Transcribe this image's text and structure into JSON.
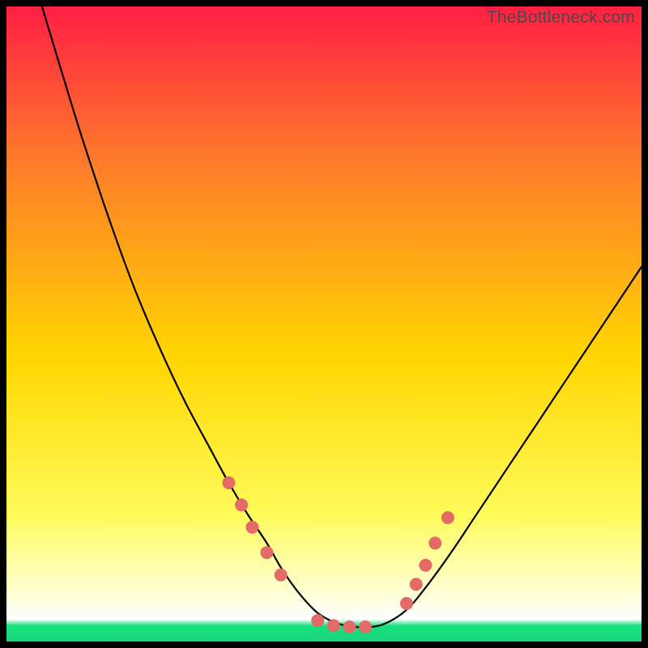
{
  "watermark": "TheBottleneck.com",
  "colors": {
    "grad_top": "#ff1f43",
    "grad_mid1": "#ff7a2c",
    "grad_mid2": "#ffd600",
    "grad_mid3": "#fffb5a",
    "grad_mid4": "#fdffd1",
    "grad_green": "#18e07f",
    "dot": "#e46a67",
    "line": "#000000"
  },
  "chart_data": {
    "type": "line",
    "title": "",
    "xlabel": "",
    "ylabel": "",
    "xlim": [
      0,
      100
    ],
    "ylim": [
      0,
      100
    ],
    "x": [
      5.6,
      8,
      12,
      16,
      20,
      24,
      28,
      32,
      35,
      38,
      41,
      43,
      45,
      47,
      49,
      51,
      53,
      55,
      57.5,
      60,
      63,
      66,
      70,
      74,
      78,
      82,
      86,
      90,
      94,
      98,
      100
    ],
    "y": [
      100,
      92,
      79,
      67,
      56,
      46.5,
      38,
      30.5,
      25,
      20,
      15.5,
      12,
      9,
      6.5,
      4.5,
      3.3,
      2.6,
      2.3,
      2.3,
      3,
      5,
      8.5,
      14,
      20,
      26,
      32,
      38,
      44,
      50,
      56,
      59
    ],
    "dots": [
      {
        "x": 35,
        "y": 25
      },
      {
        "x": 37,
        "y": 21.5
      },
      {
        "x": 38.7,
        "y": 18
      },
      {
        "x": 41,
        "y": 14
      },
      {
        "x": 43.2,
        "y": 10.5
      },
      {
        "x": 49,
        "y": 3.3
      },
      {
        "x": 51.5,
        "y": 2.5
      },
      {
        "x": 54,
        "y": 2.3
      },
      {
        "x": 56.5,
        "y": 2.3
      },
      {
        "x": 63,
        "y": 6
      },
      {
        "x": 64.5,
        "y": 9
      },
      {
        "x": 66,
        "y": 12
      },
      {
        "x": 67.5,
        "y": 15.5
      },
      {
        "x": 69.5,
        "y": 19.5
      }
    ],
    "dot_radius_px": 8
  }
}
